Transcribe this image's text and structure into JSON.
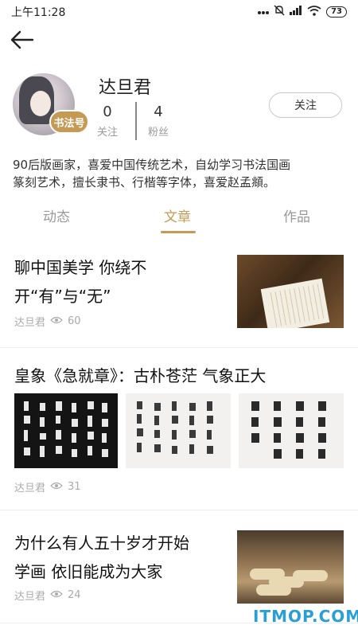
{
  "status_bar": {
    "time": "上午11:28",
    "battery": "73"
  },
  "profile": {
    "name": "达旦君",
    "badge": "书法号",
    "stats": [
      {
        "value": "0",
        "label": "关注"
      },
      {
        "value": "4",
        "label": "粉丝"
      }
    ],
    "follow_label": "关注",
    "bio_line1": "90后版画家，喜爱中国传统艺术，自幼学习书法国画",
    "bio_line2": "篆刻艺术，擅长隶书、行楷等字体，喜爱赵孟頫。"
  },
  "tabs": [
    {
      "label": "动态",
      "active": false
    },
    {
      "label": "文章",
      "active": true
    },
    {
      "label": "作品",
      "active": false
    }
  ],
  "articles": [
    {
      "title_line1": "聊中国美学 你绕不",
      "title_line2": "开“有”与“无”",
      "author": "达旦君",
      "views": "60"
    },
    {
      "title": "皇象《急就章》：古朴苍茫 气象正大",
      "author": "达旦君",
      "views": "31"
    },
    {
      "title_line1": "为什么有人五十岁才开始",
      "title_line2": "学画 依旧能成为大家",
      "author": "达旦君",
      "views": "24"
    }
  ],
  "watermark": "ITMOP.COM",
  "colors": {
    "accent": "#c49a54",
    "watermark": "#2a9fd6",
    "muted": "#999999"
  }
}
